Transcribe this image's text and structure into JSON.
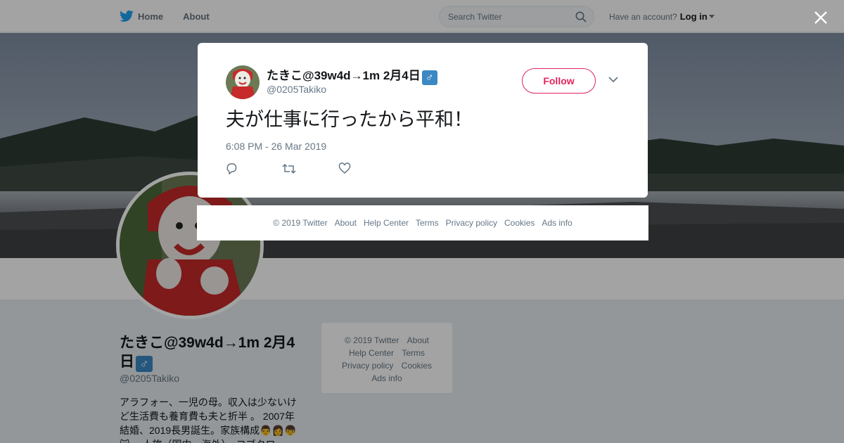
{
  "topbar": {
    "home_label": "Home",
    "about_label": "About",
    "search_placeholder": "Search Twitter",
    "have_account": "Have an account?",
    "login_label": "Log in"
  },
  "profile": {
    "name": "たきこ@39w4d→1m 2月4日",
    "name_emoji": "♂",
    "handle": "@0205Takiko",
    "bio": "アラフォー、一児の母。収入は少ないけど生活費も養育費も夫と折半 。 2007年結婚、2019長男誕生。家族構成👨👩👦 🐱 一人旅（国内・海外）、コブクロ"
  },
  "side_footer": {
    "links": [
      "© 2019 Twitter",
      "About",
      "Help Center",
      "Terms",
      "Privacy policy",
      "Cookies",
      "Ads info"
    ]
  },
  "tweet": {
    "author_name": "たきこ@39w4d→1m 2月4日",
    "author_emoji": "♂",
    "author_handle": "@0205Takiko",
    "follow_label": "Follow",
    "text": "夫が仕事に行ったから平和！",
    "timestamp": "6:08 PM - 26 Mar 2019"
  },
  "bottom_footer": {
    "links": [
      "© 2019 Twitter",
      "About",
      "Help Center",
      "Terms",
      "Privacy policy",
      "Cookies",
      "Ads info"
    ]
  },
  "colors": {
    "twitter_blue": "#1da1f2",
    "follow_red": "#e0245e",
    "overlay": "rgba(0,0,0,0.36)"
  },
  "icons": [
    "twitter-bird-icon",
    "search-icon",
    "close-icon",
    "chevron-down-icon",
    "reply-icon",
    "retweet-icon",
    "like-icon"
  ]
}
